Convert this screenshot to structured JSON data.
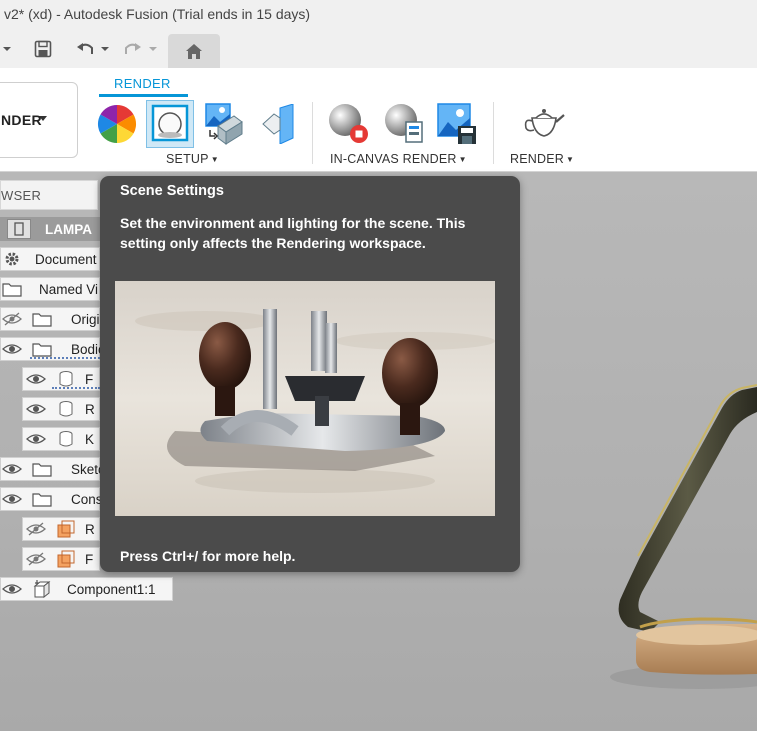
{
  "window": {
    "title": "v2* (xd) - Autodesk Fusion (Trial ends in 15 days)"
  },
  "workspace": {
    "label": "NDER"
  },
  "ribbon": {
    "active_tab": "RENDER",
    "groups": [
      {
        "label": "SETUP"
      },
      {
        "label": "IN-CANVAS RENDER"
      },
      {
        "label": "RENDER"
      }
    ]
  },
  "browser": {
    "header": "WSER",
    "root": "LAMPA",
    "items": [
      {
        "label": "Document"
      },
      {
        "label": "Named Vi"
      },
      {
        "label": "Origi"
      },
      {
        "label": "Bodie"
      },
      {
        "label": "F"
      },
      {
        "label": "R"
      },
      {
        "label": "K"
      },
      {
        "label": "Sketc"
      },
      {
        "label": "Cons"
      },
      {
        "label": "R"
      },
      {
        "label": "F"
      },
      {
        "label": "Component1:1"
      }
    ]
  },
  "tooltip": {
    "title": "Scene Settings",
    "description": "Set the environment and lighting for the scene. This setting only affects the Rendering workspace.",
    "help": "Press Ctrl+/ for more help."
  },
  "colors": {
    "accent": "#0696d7",
    "tooltip_bg": "#4b4b4b",
    "ribbon_bg": "#ffffff",
    "viewport_bg": "#b3b3b3"
  }
}
